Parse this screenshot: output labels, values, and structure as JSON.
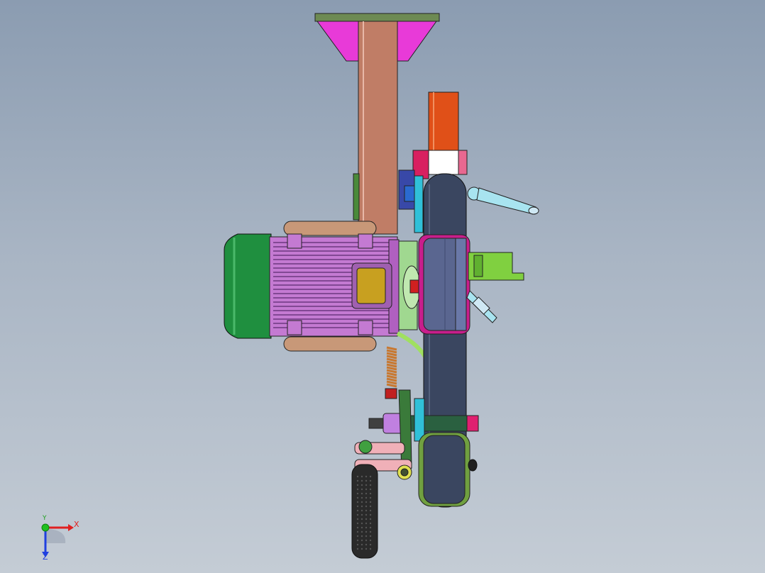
{
  "viewport": {
    "background_top": "#8b9cb1",
    "background_bottom": "#c4ccd5"
  },
  "triad": {
    "x_label": "X",
    "y_label": "Y",
    "z_label": "Z",
    "x_color": "#e02020",
    "y_color": "#20c020",
    "z_color": "#2040e0"
  },
  "model": {
    "colors": {
      "motor_housing": "#c47ad2",
      "motor_fan_cover": "#1f8f3f",
      "terminal_box": "#c8a020",
      "column": "#c07d66",
      "top_plate": "#6d8a52",
      "gusset": "#e83ad8",
      "belt_arm": "#3a4660",
      "drive_wheel": "#5a6690",
      "wheel_rim": "#c81e8c",
      "upper_tube": "#e05018",
      "handle": "#2a2a2a",
      "spring": "#c87830",
      "clamp_lever": "#a8e4f0",
      "bracket": "#80d040"
    }
  }
}
